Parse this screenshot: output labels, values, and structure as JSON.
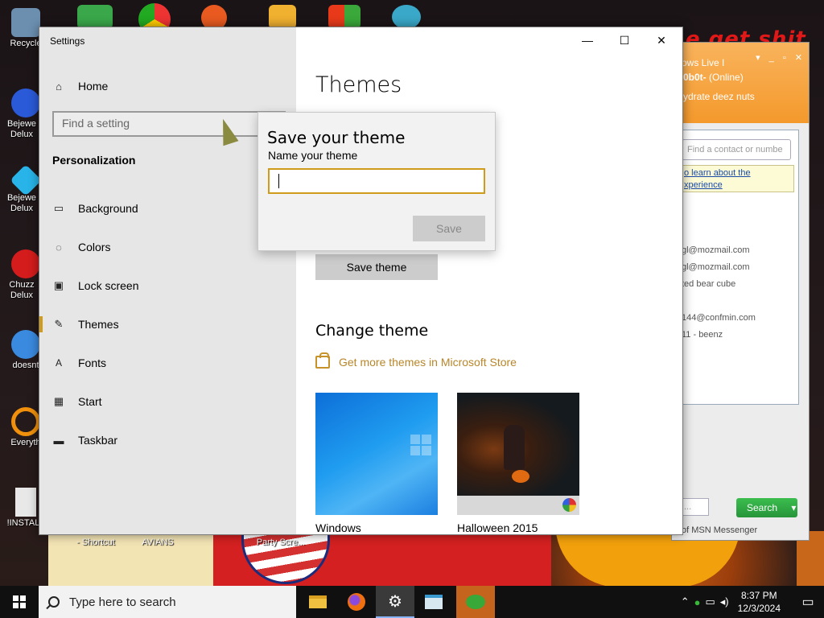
{
  "desktop": {
    "graffiti": "e get shit",
    "icons": [
      {
        "name": "recycle-bin",
        "label": "Recycle",
        "color": "#6c8fb0"
      },
      {
        "name": "bejeweled-1",
        "label": "Bejewe Delux",
        "color": "#2a5ad8"
      },
      {
        "name": "bejeweled-2",
        "label": "Bejewe Delux",
        "color": "#28b4e8"
      },
      {
        "name": "chuzzle",
        "label": "Chuzz Delux",
        "color": "#d41c1c"
      },
      {
        "name": "doesnt",
        "label": "doesnt",
        "color": "#3a8ae0"
      },
      {
        "name": "everything",
        "label": "Everyth",
        "color": "#f0900c"
      },
      {
        "name": "install",
        "label": "!INSTALL",
        "color": "#e8e8e8"
      }
    ],
    "bottom_labels": [
      "- Shortcut",
      "AVIANS",
      "Party Scre..."
    ]
  },
  "msn": {
    "header_title": "ows Live I",
    "user": "0b0t-",
    "status": "(Online)",
    "message": "ydrate deez nuts",
    "find_placeholder": "Find a contact or numbe",
    "tip_line1": "o learn about the",
    "tip_line2": "xperience",
    "contacts": [
      "gl@mozmail.com",
      "gl@mozmail.com",
      "ted bear cube",
      "144@confmin.com",
      "11 - beenz"
    ],
    "search_placeholder": "...",
    "search_button": "Search",
    "footer": "of MSN Messenger"
  },
  "settings": {
    "window_title": "Settings",
    "controls": {
      "minimize": "—",
      "maximize": "☐",
      "close": "✕"
    },
    "home_label": "Home",
    "search_placeholder": "Find a setting",
    "section": "Personalization",
    "nav": [
      {
        "label": "Background",
        "icon": "image-icon"
      },
      {
        "label": "Colors",
        "icon": "palette-icon"
      },
      {
        "label": "Lock screen",
        "icon": "lock-screen-icon"
      },
      {
        "label": "Themes",
        "icon": "themes-icon",
        "active": true
      },
      {
        "label": "Fonts",
        "icon": "fonts-icon"
      },
      {
        "label": "Start",
        "icon": "start-icon"
      },
      {
        "label": "Taskbar",
        "icon": "taskbar-icon"
      }
    ],
    "page_title": "Themes",
    "save_theme_button": "Save theme",
    "change_theme_heading": "Change theme",
    "store_link": "Get more themes in Microsoft Store",
    "themes": [
      {
        "name": "Windows"
      },
      {
        "name": "Halloween 2015"
      }
    ],
    "accent_color": "#d09a1a"
  },
  "dialog": {
    "title": "Save your theme",
    "label": "Name your theme",
    "value": "",
    "save_button": "Save"
  },
  "taskbar": {
    "search_placeholder": "Type here to search",
    "apps": [
      "file-explorer",
      "firefox",
      "settings",
      "notepad",
      "msn-messenger"
    ],
    "time": "8:37 PM",
    "date": "12/3/2024"
  }
}
